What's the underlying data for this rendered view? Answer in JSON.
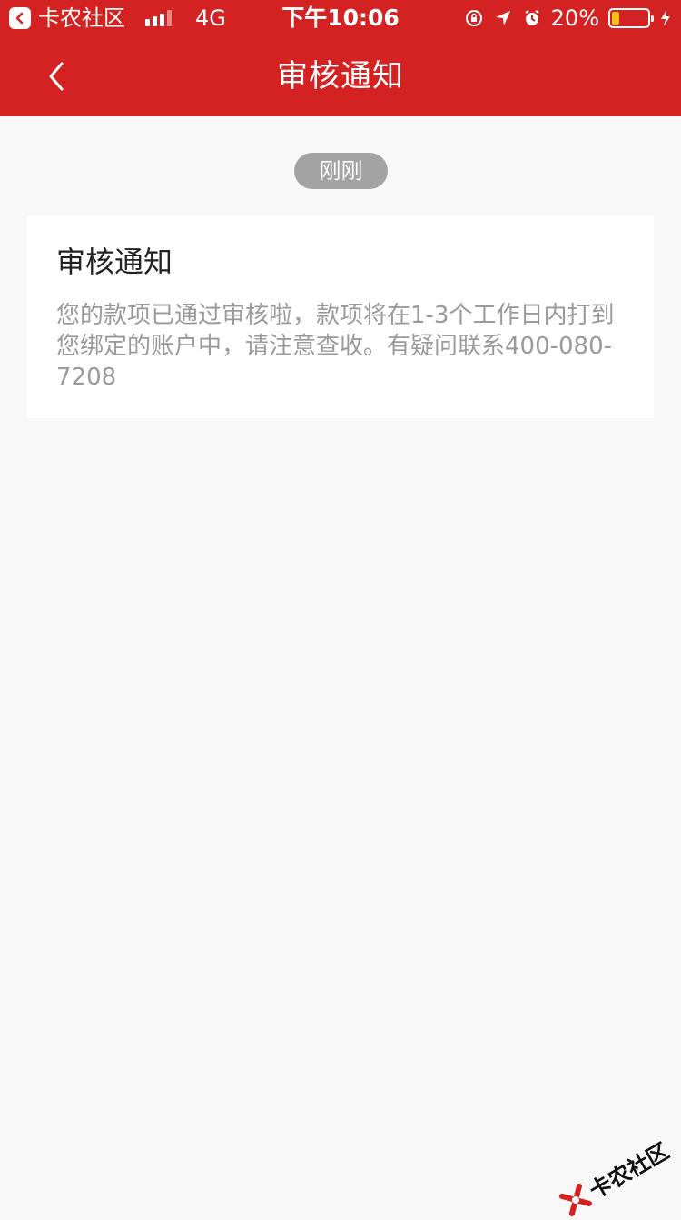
{
  "status_bar": {
    "app_name": "卡农社区",
    "network": "4G",
    "time": "下午10:06",
    "battery_percent": "20%",
    "battery_level": 0.2,
    "icons": [
      "back-arrow-icon",
      "signal-icon",
      "orientation-lock-icon",
      "location-icon",
      "alarm-icon",
      "battery-icon",
      "charging-icon"
    ]
  },
  "nav": {
    "title": "审核通知"
  },
  "message": {
    "time_label": "刚刚",
    "title": "审核通知",
    "body": "您的款项已通过审核啦，款项将在1-3个工作日内打到您绑定的账户中，请注意查收。有疑问联系400-080-7208"
  },
  "watermark": {
    "text": "卡农社区"
  },
  "colors": {
    "header_red": "#d42222",
    "page_bg": "#f8f8f8",
    "pill_gray": "#a3a3a3",
    "body_text_gray": "#9a9a9a",
    "battery_yellow": "#f6c21b"
  }
}
